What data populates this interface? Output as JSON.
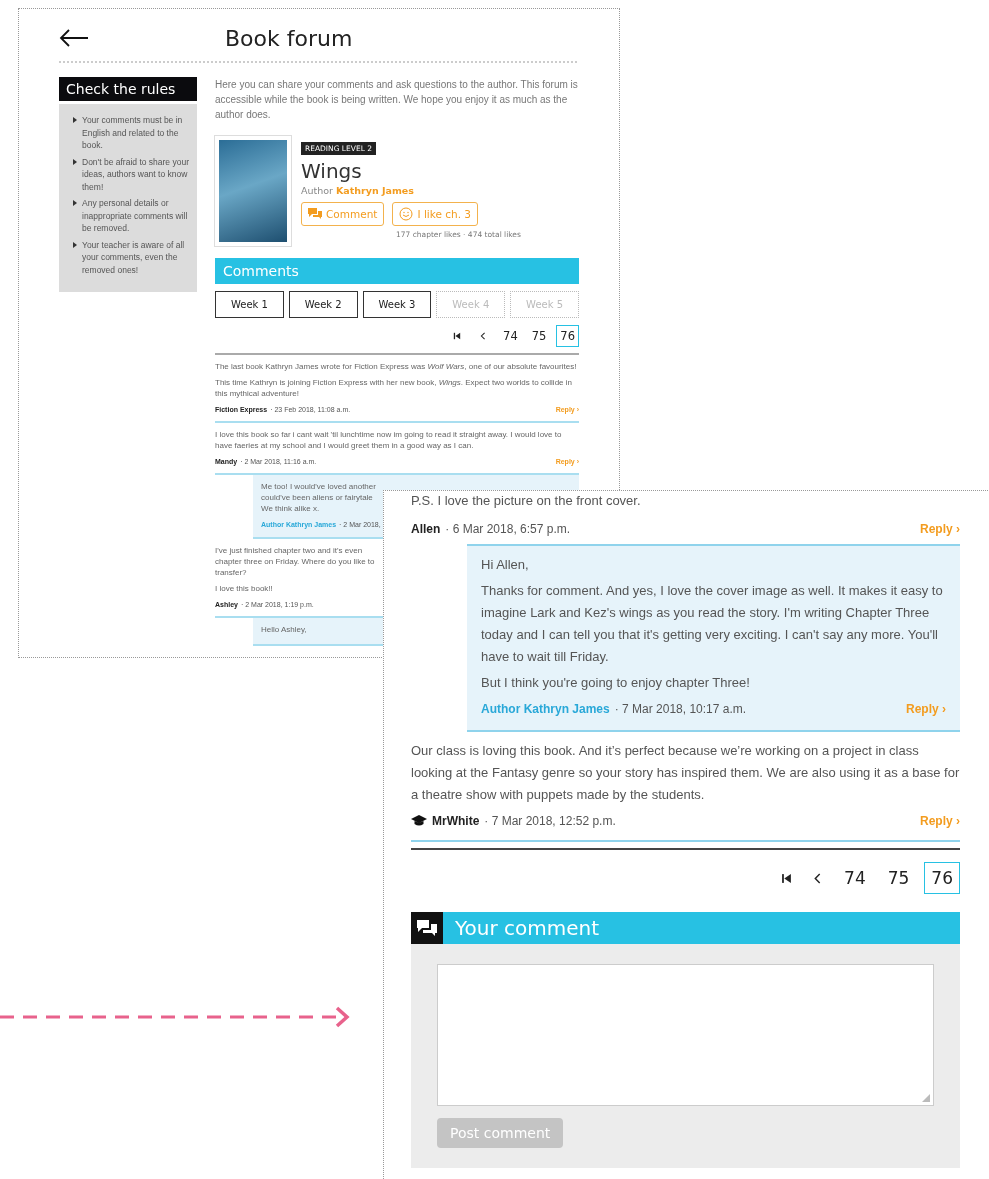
{
  "forum_page": {
    "title": "Book forum",
    "rules": {
      "title": "Check the rules",
      "items": [
        "Your comments must be in English and related to the book.",
        "Don't be afraid to share your ideas, authors want to know them!",
        "Any personal details or inappropriate comments will be removed.",
        "Your teacher is aware of all your comments, even the removed ones!"
      ]
    },
    "intro": "Here you can share your comments and ask questions to the author. This forum is accessible while the book is being written. We hope you enjoy it as much as the author does.",
    "book": {
      "level_badge": "READING LEVEL 2",
      "title": "Wings",
      "author_label": "Author",
      "author": "Kathryn James",
      "buttons": [
        {
          "kind": "comment",
          "label": "Comment"
        },
        {
          "kind": "like",
          "label": "I like ch. 3"
        }
      ],
      "likes": "177 chapter likes · 474 total likes"
    },
    "comments_header": "Comments",
    "weeks": [
      {
        "label": "Week 1",
        "disabled": false
      },
      {
        "label": "Week 2",
        "disabled": false
      },
      {
        "label": "Week 3",
        "disabled": false
      },
      {
        "label": "Week 4",
        "disabled": true
      },
      {
        "label": "Week 5",
        "disabled": true
      }
    ],
    "pages": [
      {
        "label": "74",
        "selected": false
      },
      {
        "label": "75",
        "selected": false
      },
      {
        "label": "76",
        "selected": true
      }
    ],
    "comments": [
      {
        "kind": "comment",
        "paragraphs": [
          "The last book Kathryn James wrote for Fiction Express was *Wolf Wars*, one of our absolute favourites!",
          "This time Kathryn is joining Fiction Express with her new book, *Wings*. Expect two worlds to collide in this mythical adventure!"
        ],
        "author": "Fiction Express",
        "date": "· 23 Feb 2018, 11:08 a.m.",
        "reply": "Reply ›"
      },
      {
        "kind": "comment",
        "paragraphs": [
          "I love this book so far i cant wait 'til lunchtime now im going to read it straight away. I would love to have faeries at my school and I would greet them in a good way as I can."
        ],
        "author": "Mandy",
        "date": "· 2 Mar 2018, 11:16 a.m.",
        "reply": "Reply ›"
      },
      {
        "kind": "reply",
        "lines": [
          "Me too! I would've loved another",
          "could've been aliens or fairytale",
          "We think alike x."
        ],
        "author": "Author Kathryn James",
        "date": "· 2 Mar 2018,"
      },
      {
        "kind": "comment",
        "lines": [
          "I've just finished chapter two and it's even",
          "chapter three on Friday. Where do you like to",
          "transfer?"
        ],
        "paragraphs": [
          "I love this book!!"
        ],
        "author": "Ashley",
        "date": "· 2 Mar 2018, 1:19 p.m."
      },
      {
        "kind": "reply",
        "lines": [
          "Hello Ashley,"
        ]
      }
    ]
  },
  "comments_page": {
    "top_line": "P.S. I love the picture on the front cover.",
    "comments": [
      {
        "kind": "meta",
        "author": "Allen",
        "date": "· 6 Mar 2018, 6:57 p.m.",
        "reply": "Reply ›"
      },
      {
        "kind": "reply",
        "paragraphs": [
          "Hi Allen,",
          "Thanks for comment. And yes, I love the cover image as well. It makes it easy to imagine Lark and Kez's wings as you read the story. I'm writing Chapter Three today and I can tell you that it's getting very exciting. I can't say any more. You'll have to wait till Friday.",
          "But I think you're going to enjoy chapter Three!"
        ],
        "author": "Author Kathryn James",
        "date": "· 7 Mar 2018, 10:17 a.m.",
        "reply": "Reply ›"
      },
      {
        "kind": "teacher_comment",
        "paragraphs": [
          "Our class is loving this book. And it’s perfect because we’re working on a project in class looking at the Fantasy genre so your story has inspired them. We are also using it as a base for a theatre show with puppets made by the students."
        ],
        "author": "MrWhite",
        "date": "· 7 Mar 2018, 12:52 p.m.",
        "reply": "Reply ›"
      }
    ],
    "pages": [
      {
        "label": "74",
        "selected": false
      },
      {
        "label": "75",
        "selected": false
      },
      {
        "label": "76",
        "selected": true
      }
    ],
    "your_comment": {
      "title": "Your comment",
      "button": {
        "label": "Post comment",
        "disabled": true
      }
    }
  }
}
